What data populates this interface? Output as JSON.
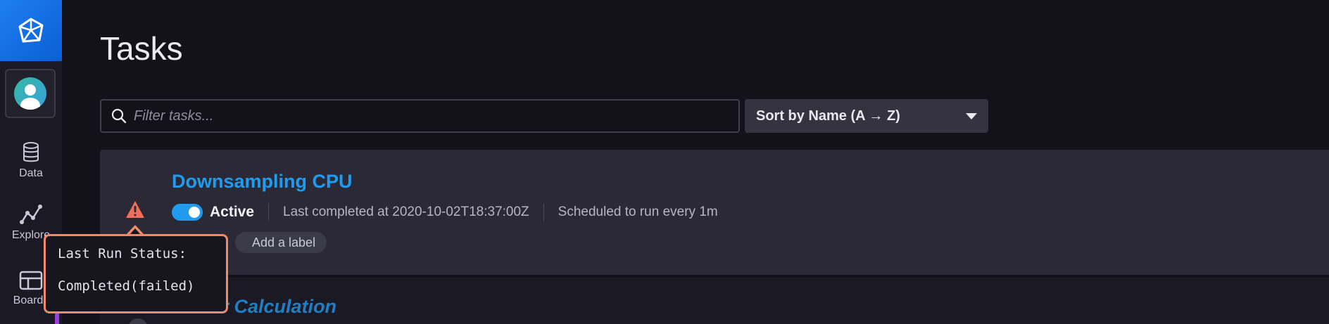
{
  "sidebar": {
    "logo": "influx-logo-icon",
    "nav": [
      {
        "label": "Data",
        "icon": "database-icon"
      },
      {
        "label": "Explore",
        "icon": "graph-icon"
      },
      {
        "label": "Boards",
        "icon": "dashboard-icon"
      }
    ]
  },
  "page": {
    "title": "Tasks"
  },
  "filter": {
    "placeholder": "Filter tasks..."
  },
  "sort": {
    "label": "Sort by Name (A → Z)"
  },
  "tasks": [
    {
      "name": "Downsampling CPU",
      "status": "Active",
      "enabled": true,
      "last_completed": "Last completed at 2020-10-02T18:37:00Z",
      "schedule": "Scheduled to run every 1m",
      "label_button": "Add a label",
      "status_icon": "warning-triangle-icon"
    },
    {
      "name": "Power Calculation"
    }
  ],
  "tooltip": {
    "line1": "Last Run Status:",
    "line2": "Completed(failed)"
  },
  "colors": {
    "accent": "#1f9cf0",
    "warning": "#ee8a6a",
    "background": "#13121a"
  }
}
